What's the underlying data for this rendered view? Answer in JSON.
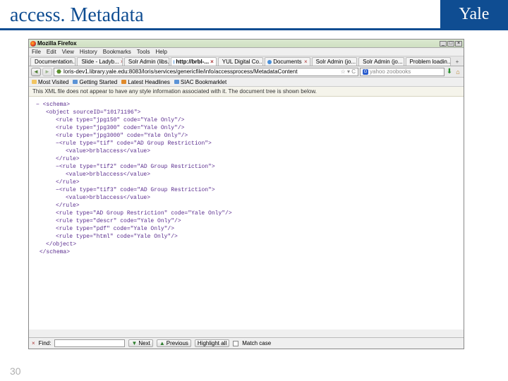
{
  "slide": {
    "title": "access. Metadata",
    "page_number": "30",
    "logo_text": "Yale"
  },
  "browser": {
    "window_title": "Mozilla Firefox",
    "menus": {
      "file": "File",
      "edit": "Edit",
      "view": "View",
      "history": "History",
      "bookmarks": "Bookmarks",
      "tools": "Tools",
      "help": "Help"
    },
    "tabs": [
      {
        "label": "Documentation..."
      },
      {
        "label": "Slide - Ladyb..."
      },
      {
        "label": "Solr Admin (libs..."
      },
      {
        "label": "http://brbl-..."
      },
      {
        "label": "YUL Digital Co..."
      },
      {
        "label": "Documents"
      },
      {
        "label": "Solr Admin (jo..."
      },
      {
        "label": "Solr Admin (jo..."
      },
      {
        "label": "Problem loadin..."
      }
    ],
    "tab_plus": "+",
    "url": "loris-dev1.library.yale.edu:8083/loris/services/genericfile/info/accessprocess/MetadataContent",
    "search_placeholder": "yahoo zoobooks",
    "bookmarks": [
      {
        "label": "Most Visited"
      },
      {
        "label": "Getting Started"
      },
      {
        "label": "Latest Headlines"
      },
      {
        "label": "SIAC Bookmarklet"
      }
    ],
    "info_strip": "This XML file does not appear to have any style information associated with it. The document tree is shown below.",
    "findbar": {
      "find_label": "Find:",
      "next": "Next",
      "prev": "Previous",
      "highlight": "Highlight all",
      "matchcase": "Match case"
    }
  },
  "xml": {
    "schema_open": "<schema>",
    "object_open": "<object sourceID=\"10171196\">",
    "rules_simple": [
      "<rule type=\"jpg150\" code=\"Yale Only\"/>",
      "<rule type=\"jpg300\" code=\"Yale Only\"/>",
      "<rule type=\"jpg3000\" code=\"Yale Only\"/>"
    ],
    "rules_block": [
      {
        "open": "<rule type=\"tif\" code=\"AD Group Restriction\">",
        "value": "<value>brblaccess</value>",
        "close": "</rule>"
      },
      {
        "open": "<rule type=\"tif2\" code=\"AD Group Restriction\">",
        "value": "<value>brblaccess</value>",
        "close": "</rule>"
      },
      {
        "open": "<rule type=\"tif3\" code=\"AD Group Restriction\">",
        "value": "<value>brblaccess</value>",
        "close": "</rule>"
      }
    ],
    "rules_tail": [
      "<rule type=\"AD Group Restriction\" code=\"Yale Only\"/>",
      "<rule type=\"descr\" code=\"Yale Only\"/>",
      "<rule type=\"pdf\" code=\"Yale Only\"/>",
      "<rule type=\"html\" code=\"Yale Only\"/>"
    ],
    "object_close": "</object>",
    "schema_close": "</schema>"
  }
}
